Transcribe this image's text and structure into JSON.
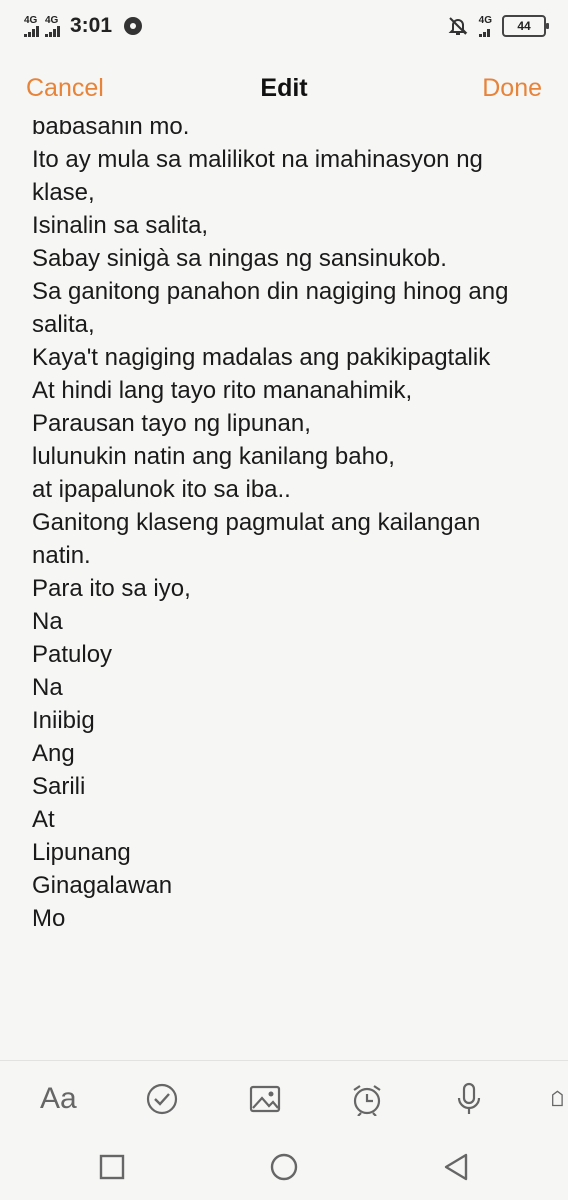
{
  "status_bar": {
    "network1": "4G",
    "network2": "4G",
    "time": "3:01",
    "right_network": "4G",
    "battery": "44"
  },
  "header": {
    "cancel_label": "Cancel",
    "title": "Edit",
    "done_label": "Done"
  },
  "note": {
    "lines": [
      "babasahin mo.",
      "Ito ay mula sa malilikot na imahinasyon ng",
      "klase,",
      "Isinalin sa salita,",
      "Sabay sinigà sa ningas ng sansinukob.",
      "Sa ganitong panahon din nagiging hinog ang",
      "salita,",
      "Kaya't nagiging madalas ang pakikipagtalik",
      "At hindi lang tayo rito mananahimik,",
      "Parausan tayo ng lipunan,",
      "lulunukin natin ang kanilang baho,",
      "at ipapalunok ito sa iba..",
      "Ganitong klaseng pagmulat ang kailangan",
      "natin.",
      "Para ito sa iyo,",
      "Na",
      "Patuloy",
      "Na",
      "Iniibig",
      "Ang",
      "Sarili",
      "At",
      "Lipunang",
      "Ginagalawan",
      "Mo"
    ]
  },
  "toolbar": {
    "text_format_label": "Aa",
    "icons": [
      "text-format-icon",
      "checklist-icon",
      "image-icon",
      "alarm-icon",
      "microphone-icon",
      "more-icon"
    ]
  },
  "colors": {
    "accent": "#e8833a",
    "background": "#f6f6f4",
    "text": "#1a1a1a"
  }
}
